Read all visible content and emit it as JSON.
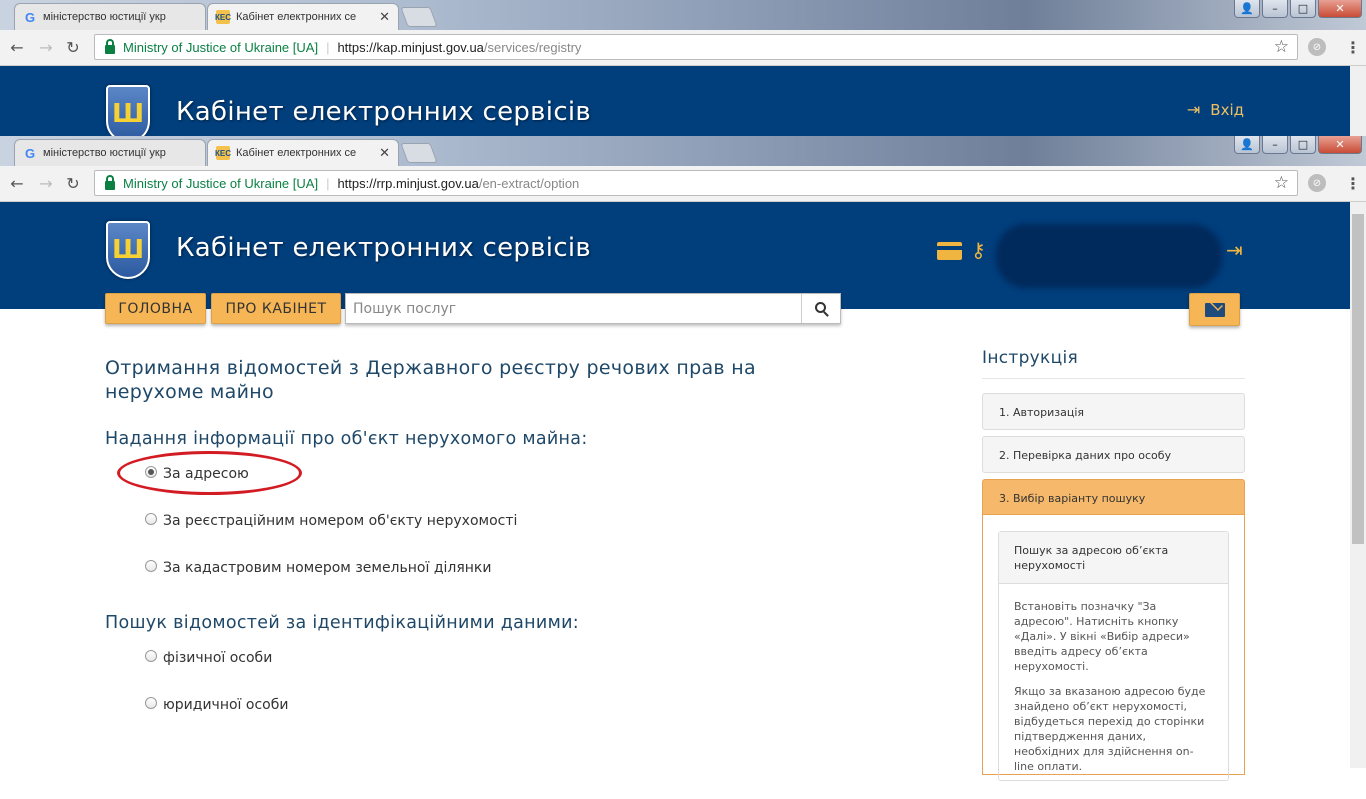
{
  "browser_back": {
    "tabs": [
      {
        "title": "міністерство юстиції укр",
        "favicon": "G"
      },
      {
        "title": "Кабінет електронних се",
        "favicon": "КЕС"
      }
    ],
    "org": "Ministry of Justice of Ukraine [UA]",
    "url_host": "https://kap.minjust.gov.ua",
    "url_path": "/services/registry"
  },
  "browser": {
    "tabs": [
      {
        "title": "міністерство юстиції укр",
        "favicon": "G"
      },
      {
        "title": "Кабінет електронних се",
        "favicon": "КЕС"
      }
    ],
    "org": "Ministry of Justice of Ukraine [UA]",
    "url_host": "https://rrp.minjust.gov.ua",
    "url_path": "/en-extract/option",
    "window_buttons": {
      "min": "–",
      "max": "□",
      "close": "✕"
    }
  },
  "site": {
    "title": "Кабінет електронних сервісів",
    "login_label": "Вхід"
  },
  "nav": {
    "home_label": "ГОЛОВНА",
    "about_label": "ПРО КАБІНЕТ",
    "search_placeholder": "Пошук послуг"
  },
  "main": {
    "heading": "Отримання відомостей з Державного реєстру речових прав на нерухоме майно",
    "section1_title": "Надання інформації про об'єкт нерухомого майна:",
    "section1_options": [
      {
        "label": "За адресою",
        "checked": true
      },
      {
        "label": "За реєстраційним номером об'єкту нерухомості",
        "checked": false
      },
      {
        "label": "За кадастровим номером земельної ділянки",
        "checked": false
      }
    ],
    "section2_title": "Пошук відомостей за ідентифікаційними даними:",
    "section2_options": [
      {
        "label": "фізичної особи",
        "checked": false
      },
      {
        "label": "юридичної особи",
        "checked": false
      }
    ]
  },
  "sidebar": {
    "title": "Інструкція",
    "steps": [
      {
        "label": "1. Авторизація"
      },
      {
        "label": "2. Перевірка даних про особу"
      },
      {
        "label": "3. Вибір варіанту пошуку"
      }
    ],
    "panel_title": "Пошук за адресою об’єкта нерухомості",
    "panel_text_1": "Встановіть позначку \"За адресою\". Натисніть кнопку «Далі». У вікні «Вибір адреси» введіть адресу об’єкта нерухомості.",
    "panel_text_2": "Якщо за вказаною адресою буде знайдено об’єкт нерухомості, відбудеться перехід до сторінки підтвердження даних, необхідних для здійснення on-line оплати."
  },
  "colors": {
    "header_bg": "#013e7c",
    "accent": "#f6b655",
    "heading_text": "#1f4868",
    "annotation": "#d31b24"
  }
}
